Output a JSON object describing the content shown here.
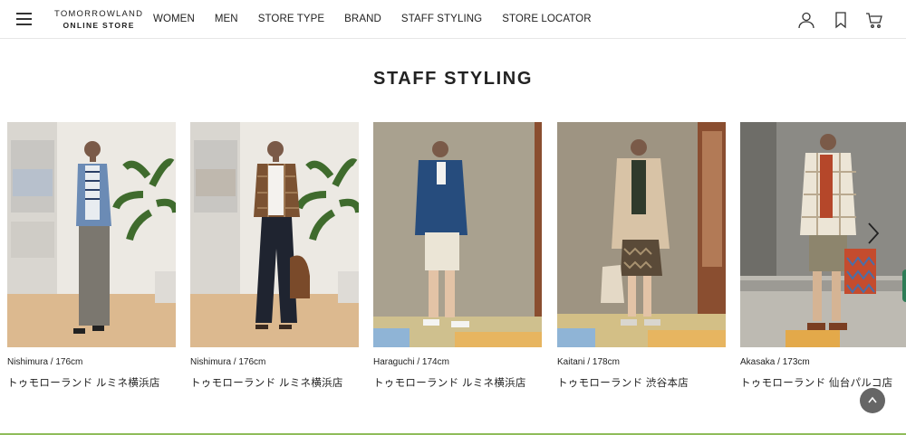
{
  "header": {
    "logo_line1": "TOMORROWLAND",
    "logo_line2": "ONLINE STORE",
    "nav": [
      "WOMEN",
      "MEN",
      "STORE TYPE",
      "BRAND",
      "STAFF STYLING",
      "STORE LOCATOR"
    ],
    "icons": [
      "user-icon",
      "bookmark-icon",
      "cart-icon"
    ]
  },
  "section": {
    "title": "STAFF STYLING"
  },
  "cards": [
    {
      "staff": "Nishimura / 176cm",
      "store": "トゥモローランド ルミネ横浜店"
    },
    {
      "staff": "Nishimura / 176cm",
      "store": "トゥモローランド ルミネ横浜店"
    },
    {
      "staff": "Haraguchi / 174cm",
      "store": "トゥモローランド ルミネ横浜店"
    },
    {
      "staff": "Kaitani / 178cm",
      "store": "トゥモローランド 渋谷本店"
    },
    {
      "staff": "Akasaka / 173cm",
      "store": "トゥモローランド 仙台パルコ店"
    }
  ],
  "colors": {
    "accent_green": "#8fbc5a",
    "back_to_top": "#666666",
    "side_tab": "#2e7d57"
  }
}
